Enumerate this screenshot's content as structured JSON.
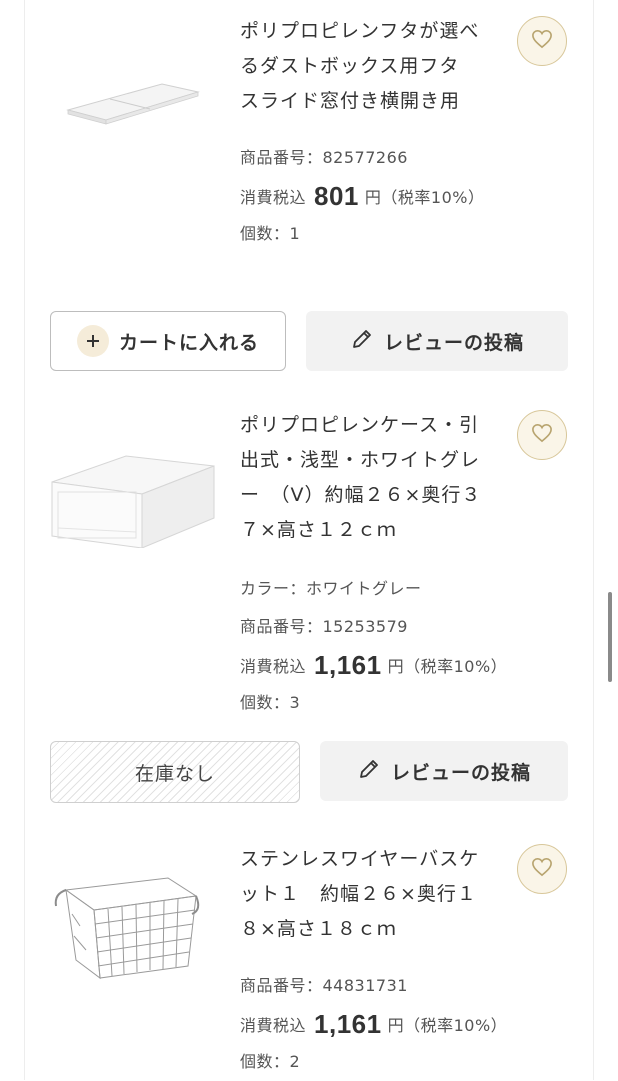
{
  "products": [
    {
      "title": "ポリプロピレンフタが選べるダストボックス用フタ　スライド窓付き横開き用",
      "color": null,
      "item_number": "商品番号：82577266",
      "price_prefix": "消費税込",
      "price": "801",
      "price_suffix": "円（税率10%）",
      "quantity": "個数：1",
      "action_label": "カートに入れる",
      "action_type": "cart",
      "review_label": "レビューの投稿",
      "favorite_icon": "heart-icon"
    },
    {
      "title": "ポリプロピレンケース・引出式・浅型・ホワイトグレー　（V）約幅２６×奥行３７×高さ１２ｃｍ",
      "color": "カラー：ホワイトグレー",
      "item_number": "商品番号：15253579",
      "price_prefix": "消費税込",
      "price": "1,161",
      "price_suffix": "円（税率10%）",
      "quantity": "個数：3",
      "action_label": "在庫なし",
      "action_type": "soldout",
      "review_label": "レビューの投稿",
      "favorite_icon": "heart-icon"
    },
    {
      "title": "ステンレスワイヤーバスケット１　約幅２６×奥行１８×高さ１８ｃｍ",
      "color": null,
      "item_number": "商品番号：44831731",
      "price_prefix": "消費税込",
      "price": "1,161",
      "price_suffix": "円（税率10%）",
      "quantity": "個数：2",
      "favorite_icon": "heart-icon"
    }
  ],
  "colors": {
    "favorite_bg": "#faf5e8",
    "favorite_border": "#d8c79a",
    "review_bg": "#f2f2f2",
    "cart_plus_bg": "#f5ecd9"
  }
}
